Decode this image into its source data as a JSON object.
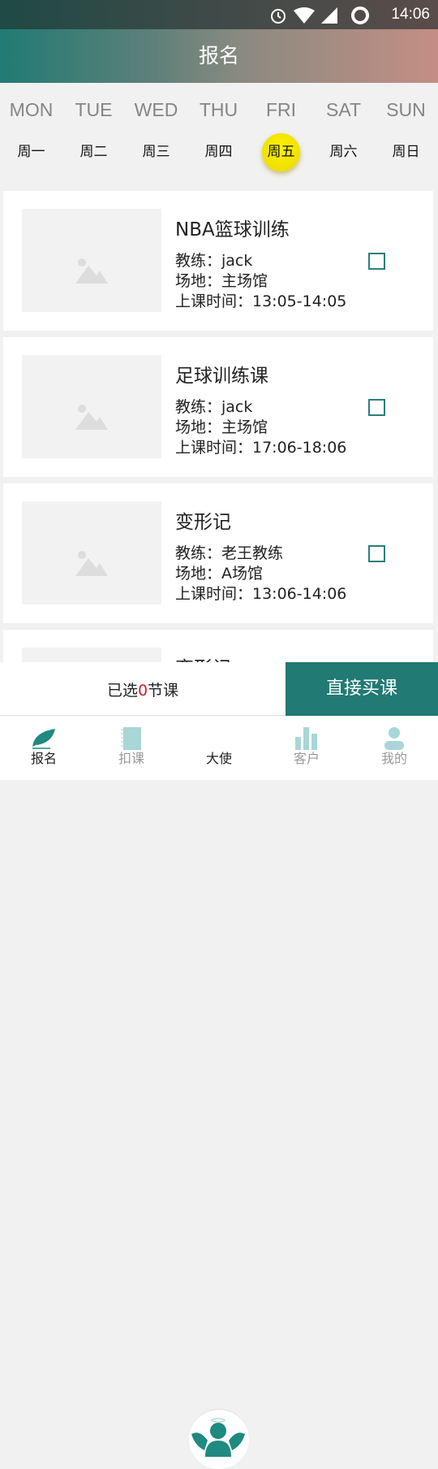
{
  "status_bar": {
    "time": "14:06",
    "icons": [
      "alarm-icon",
      "wifi-icon",
      "signal-icon",
      "battery-ring-icon"
    ]
  },
  "header": {
    "title": "报名"
  },
  "week": {
    "days": [
      {
        "en": "MON",
        "cn": "周一"
      },
      {
        "en": "TUE",
        "cn": "周二"
      },
      {
        "en": "WED",
        "cn": "周三"
      },
      {
        "en": "THU",
        "cn": "周四"
      },
      {
        "en": "FRI",
        "cn": "周五",
        "selected": true
      },
      {
        "en": "SAT",
        "cn": "周六"
      },
      {
        "en": "SUN",
        "cn": "周日"
      }
    ],
    "selected_color": "#fff200"
  },
  "courses": [
    {
      "title": "NBA篮球训练",
      "coach": "教练：jack",
      "venue": "场地：主场馆",
      "time": "上课时间：13:05-14:05",
      "checked": false
    },
    {
      "title": "足球训练课",
      "coach": "教练：jack",
      "venue": "场地：主场馆",
      "time": "上课时间：17:06-18:06",
      "checked": false
    },
    {
      "title": "变形记",
      "coach": "教练：老王教练",
      "venue": "场地：A场馆",
      "time": "上课时间：13:06-14:06",
      "checked": false
    },
    {
      "title": "变形记"
    }
  ],
  "footer": {
    "selected_prefix": "已选",
    "selected_count": "0",
    "selected_suffix": "节课",
    "buy_label": "直接买课"
  },
  "tabs": [
    {
      "label": "报名",
      "icon": "feather-icon",
      "active": true
    },
    {
      "label": "扣课",
      "icon": "notebook-icon"
    },
    {
      "label": "大使",
      "icon": "angel-icon"
    },
    {
      "label": "客户",
      "icon": "bar-chart-icon"
    },
    {
      "label": "我的",
      "icon": "person-icon"
    }
  ],
  "colors": {
    "accent": "#217a73",
    "count": "#d0202a"
  }
}
